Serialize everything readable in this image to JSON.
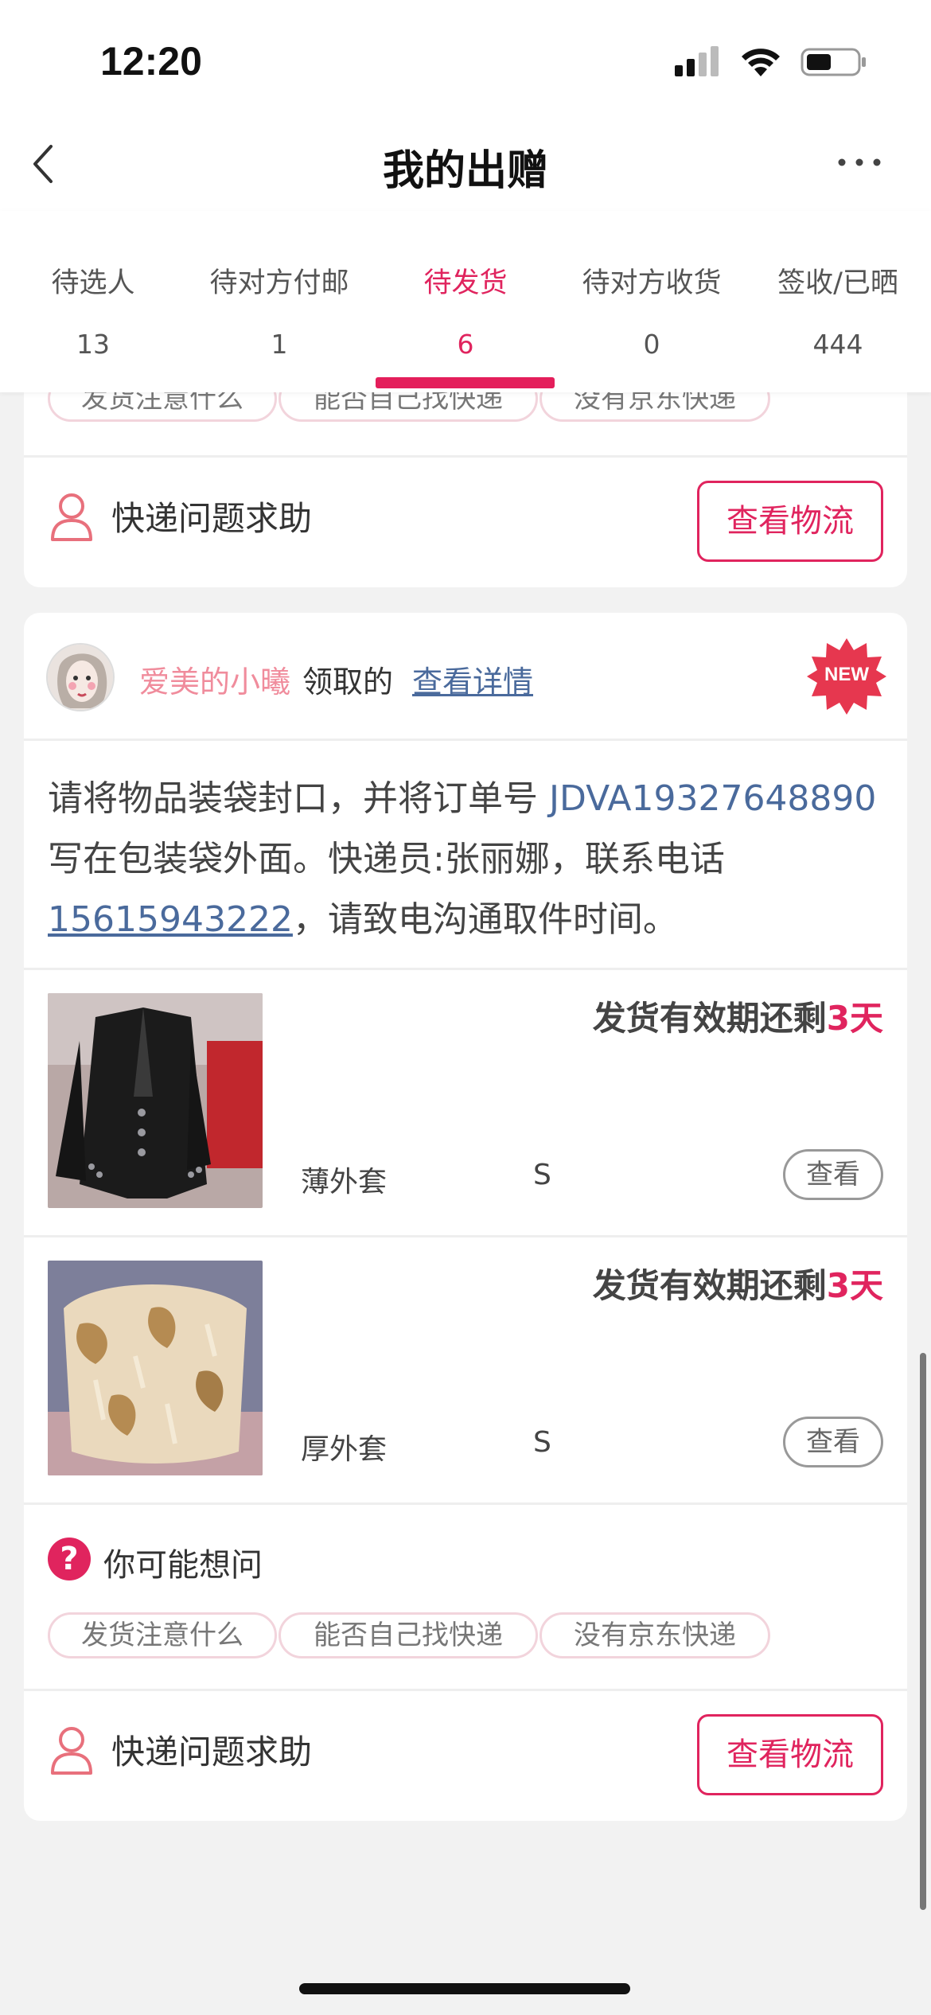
{
  "status_bar": {
    "time": "12:20"
  },
  "nav": {
    "title": "我的出赠"
  },
  "tabs": [
    {
      "label": "待选人",
      "count": "13"
    },
    {
      "label": "待对方付邮",
      "count": "1"
    },
    {
      "label": "待发货",
      "count": "6",
      "active": true
    },
    {
      "label": "待对方收货",
      "count": "0"
    },
    {
      "label": "签收/已晒",
      "count": "444"
    }
  ],
  "faq": {
    "title": "你可能想问",
    "chips": [
      "发货注意什么",
      "能否自己找快递",
      "没有京东快递"
    ]
  },
  "help": {
    "label": "快递问题求助",
    "button": "查看物流"
  },
  "order": {
    "donee": "爱美的小曦",
    "received_text": "领取的",
    "details_link": "查看详情",
    "new_badge": "NEW",
    "instruction": {
      "part1": "请将物品装袋封口，并将订单号 ",
      "order_no": "JDVA19327648890",
      "part2": " 写在包装袋外面。快递员:张丽娜，联系电话",
      "phone": "15615943222",
      "part3": "，请致电沟通取件时间。"
    },
    "items": [
      {
        "deadline_prefix": "发货有效期还剩",
        "deadline_days": "3天",
        "name": "薄外套",
        "size": "S",
        "view": "查看"
      },
      {
        "deadline_prefix": "发货有效期还剩",
        "deadline_days": "3天",
        "name": "厚外套",
        "size": "S",
        "view": "查看"
      }
    ]
  },
  "colors": {
    "accent": "#e0245e",
    "link": "#4a6a9c",
    "donee": "#f08c9c"
  }
}
